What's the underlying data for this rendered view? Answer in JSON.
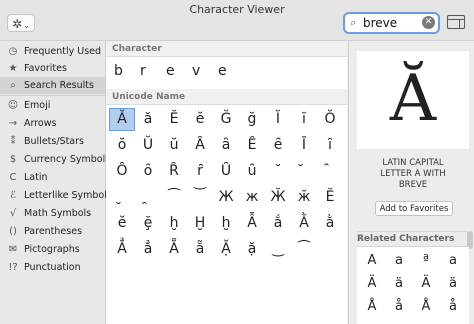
{
  "window": {
    "title": "Character Viewer"
  },
  "toolbar": {
    "gear_glyph": "✲",
    "chevron_glyph": "⌄"
  },
  "search": {
    "value": "breve",
    "placeholder": "Search",
    "icon": "search-icon",
    "clear_icon": "clear-icon"
  },
  "sidebar": {
    "items": [
      {
        "label": "Frequently Used",
        "icon": "clock-icon",
        "glyph": "◷"
      },
      {
        "label": "Favorites",
        "icon": "star-icon",
        "glyph": "★"
      },
      {
        "label": "Search Results",
        "icon": "search-icon",
        "glyph": "⌕",
        "selected": true
      },
      {
        "label": "Emoji",
        "icon": "emoji-icon",
        "glyph": "☺"
      },
      {
        "label": "Arrows",
        "icon": "arrow-icon",
        "glyph": "→"
      },
      {
        "label": "Bullets/Stars",
        "icon": "bullets-icon",
        "glyph": "⁑"
      },
      {
        "label": "Currency Symbols",
        "icon": "currency-icon",
        "glyph": "$"
      },
      {
        "label": "Latin",
        "icon": "latin-icon",
        "glyph": "C"
      },
      {
        "label": "Letterlike Symbols",
        "icon": "letterlike-icon",
        "glyph": "ℰ"
      },
      {
        "label": "Math Symbols",
        "icon": "math-icon",
        "glyph": "√"
      },
      {
        "label": "Parentheses",
        "icon": "parentheses-icon",
        "glyph": "()"
      },
      {
        "label": "Pictographs",
        "icon": "pictographs-icon",
        "glyph": "✉"
      },
      {
        "label": "Punctuation",
        "icon": "punctuation-icon",
        "glyph": "!?"
      }
    ]
  },
  "main": {
    "character_header": "Character",
    "matched_chars": [
      "b",
      "r",
      "e",
      "v",
      "e"
    ],
    "unicode_header": "Unicode Name",
    "grid": [
      [
        "Ă",
        "ă",
        "Ĕ",
        "ĕ",
        "Ğ",
        "ğ",
        "Ĭ",
        "ĭ",
        "Ŏ"
      ],
      [
        "ŏ",
        "Ŭ",
        "ŭ",
        "Ȃ",
        "ȃ",
        "Ȇ",
        "ȇ",
        "Ȋ",
        "ȋ"
      ],
      [
        "Ȏ",
        "ȏ",
        "Ȓ",
        "ȓ",
        "Ȗ",
        "ȗ",
        "˘",
        "̆",
        "̑"
      ],
      [
        "̮",
        "̯",
        "⁀",
        "͝",
        "Ж",
        "ж",
        "Ӂ",
        "ӂ",
        "Ӗ"
      ],
      [
        "ӗ",
        "ḝ",
        "ḫ",
        "Ḫ",
        "ḫ",
        "Ẫ",
        "ắ",
        "Ằ",
        "ằ"
      ],
      [
        "Ẳ",
        "ẳ",
        "Ẵ",
        "ẵ",
        "Ặ",
        "ặ",
        "‿",
        "⁀",
        ""
      ]
    ]
  },
  "inspector": {
    "preview_char": "Ă",
    "name_lines": [
      "LATIN CAPITAL",
      "LETTER A WITH",
      "BREVE"
    ],
    "favorites_button": "Add to Favorites",
    "related_header": "Related Characters",
    "related": [
      [
        "A",
        "a",
        "ª",
        "a"
      ],
      [
        "Ä",
        "ä",
        "Ä",
        "ä"
      ],
      [
        "Å",
        "å",
        "Å",
        "å"
      ]
    ]
  }
}
